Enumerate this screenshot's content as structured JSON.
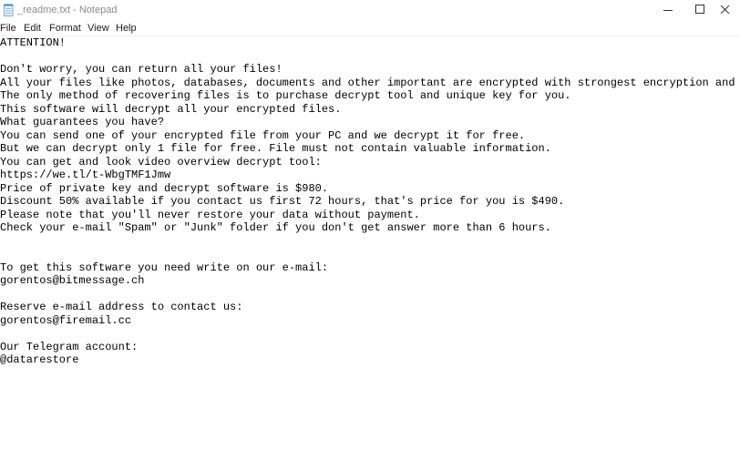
{
  "window": {
    "title": "_readme.txt - Notepad",
    "icons": {
      "app": "notepad-icon",
      "minimize": "minimize-icon",
      "maximize": "maximize-icon",
      "close": "close-icon"
    }
  },
  "menu": {
    "file": "File",
    "edit": "Edit",
    "format": "Format",
    "view": "View",
    "help": "Help"
  },
  "document": {
    "lines": [
      "ATTENTION!",
      "",
      "Don't worry, you can return all your files!",
      "All your files like photos, databases, documents and other important are encrypted with strongest encryption and unique key.",
      "The only method of recovering files is to purchase decrypt tool and unique key for you.",
      "This software will decrypt all your encrypted files.",
      "What guarantees you have?",
      "You can send one of your encrypted file from your PC and we decrypt it for free.",
      "But we can decrypt only 1 file for free. File must not contain valuable information.",
      "You can get and look video overview decrypt tool:",
      "https://we.tl/t-WbgTMF1Jmw",
      "Price of private key and decrypt software is $980.",
      "Discount 50% available if you contact us first 72 hours, that's price for you is $490.",
      "Please note that you'll never restore your data without payment.",
      "Check your e-mail \"Spam\" or \"Junk\" folder if you don't get answer more than 6 hours.",
      "",
      "",
      "To get this software you need write on our e-mail:",
      "gorentos@bitmessage.ch",
      "",
      "Reserve e-mail address to contact us:",
      "gorentos@firemail.cc",
      "",
      "Our Telegram account:",
      "@datarestore"
    ]
  }
}
